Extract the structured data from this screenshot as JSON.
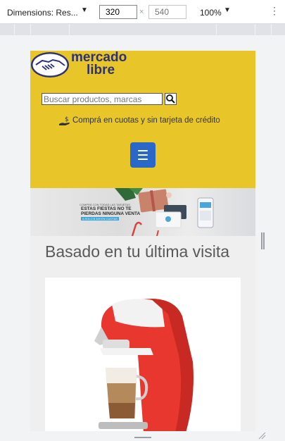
{
  "devtools": {
    "dimensions_label": "Dimensions: Res...",
    "width_value": "320",
    "height_placeholder": "540",
    "times_sign": "×",
    "zoom": "100%",
    "more_icon": "⋮"
  },
  "site": {
    "logo_line1": "mercado",
    "logo_line2": "libre",
    "search_placeholder": "Buscar productos, marcas",
    "promo_text": "Comprá en cuotas y sin tarjeta de crédito",
    "banner_small": "COMPRÁ CON TODAS LAS TARJETAS",
    "banner_title_1": "ESTAS FIESTAS NO TE",
    "banner_title_2": "PIERDAS NINGUNA VENTA",
    "banner_sub": "A SOLO $ 349 EN CUOTAS",
    "section_title": "Basado en tu última visita"
  },
  "colors": {
    "header_bg": "#e8c62a",
    "logo_blue": "#2d3277",
    "menu_button": "#2968c8",
    "product_red": "#e8372f"
  }
}
